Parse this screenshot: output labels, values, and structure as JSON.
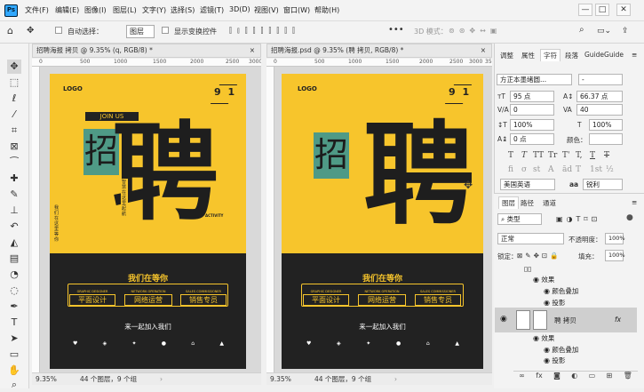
{
  "app": {
    "logo": "Ps"
  },
  "menu": [
    "文件(F)",
    "编辑(E)",
    "图像(I)",
    "图层(L)",
    "文字(Y)",
    "选择(S)",
    "滤镜(T)",
    "3D(D)",
    "视图(V)",
    "窗口(W)",
    "帮助(H)"
  ],
  "window_controls": {
    "minimize": "—",
    "maximize": "□",
    "close": "✕"
  },
  "options": {
    "auto_select": "自动选择：",
    "auto_select_target": "图层",
    "show_transform": "显示变换控件",
    "mode_3d": "3D 模式："
  },
  "tabs": [
    {
      "label": "招聘海报 拷贝 @ 9.35% (q, RGB/8) *",
      "close": "×"
    },
    {
      "label": "招聘海报.psd @ 9.35% (聘 拷贝, RGB/8) *",
      "close": "×"
    }
  ],
  "ruler_left": [
    "0",
    "500",
    "1000",
    "1500",
    "2000",
    "2500",
    "3000"
  ],
  "ruler_right": [
    "0",
    "500",
    "1000",
    "1500",
    "2000",
    "2500",
    "3000",
    "35"
  ],
  "poster": {
    "logo": "LOGO",
    "date_num": "9 1",
    "join_us": "JOIN US",
    "char_zhao": "招",
    "char_pin": "聘",
    "vertical_text": "智慧在这里起航",
    "side_text": "我们在这里等你",
    "activity": "ACTIVITY",
    "waiting": "我们在等你",
    "jobs": [
      {
        "en": "GRAPHIC DESIGNER",
        "cn": "平面设计"
      },
      {
        "en": "NETWORK OPERATION",
        "cn": "网络运营"
      },
      {
        "en": "SALES COMMISSIONER",
        "cn": "销售专员"
      }
    ],
    "join_text": "来一起加入我们"
  },
  "status_left": {
    "zoom": "9.35%",
    "info": "44 个图层，9 个组"
  },
  "status_right": {
    "zoom": "9.35%",
    "info": "44 个图层，9 个组"
  },
  "panel_top_tabs": [
    "调整",
    "属性",
    "字符",
    "段落",
    "GuideGuide"
  ],
  "character": {
    "font": "方正本墨绪圆...",
    "style": "-",
    "size": "95 点",
    "leading": "66.37 点",
    "kerning": "0",
    "tracking": "40",
    "vscale": "100%",
    "hscale": "100%",
    "baseline": "0 点",
    "color_label": "颜色：",
    "language": "美国英语",
    "aa_label": "aa",
    "aa": "锐利"
  },
  "text_styles": [
    "T",
    "T",
    "TT",
    "Tr",
    "T'",
    "T,",
    "T",
    "T"
  ],
  "opentype": [
    "fi",
    "σ",
    "st",
    "A",
    "ād",
    "T",
    "1st",
    "½"
  ],
  "layers_tabs": [
    "图层",
    "路径",
    "通道"
  ],
  "layers": {
    "kind": "类型",
    "blend": "正常",
    "opacity_label": "不透明度：",
    "opacity": "100%",
    "lock_label": "锁定：",
    "fill_label": "填充：",
    "fill": "100%",
    "rows": [
      {
        "name": "效果"
      },
      {
        "name": "颜色叠加"
      },
      {
        "name": "投影"
      },
      {
        "name": "聘 拷贝",
        "fx": "fx"
      },
      {
        "name": "效果"
      },
      {
        "name": "颜色叠加"
      },
      {
        "name": "投影"
      }
    ]
  },
  "colors": {
    "accent": "#31a8ff",
    "poster_yellow": "#f7c52c",
    "poster_dark": "#222222",
    "highlight_green": "#4f9a86"
  }
}
